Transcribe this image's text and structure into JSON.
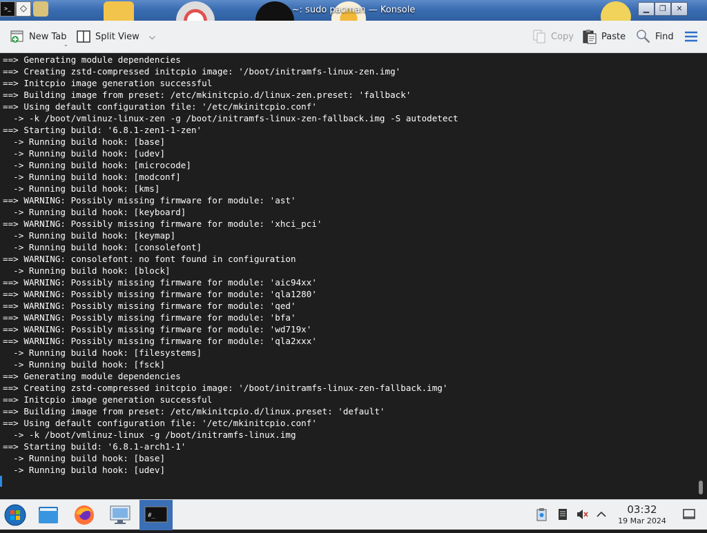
{
  "window": {
    "title": "~: sudo pacman — Konsole",
    "controls": [
      "minimize",
      "maximize",
      "close"
    ]
  },
  "toolbar": {
    "new_tab_label": "New Tab",
    "split_view_label": "Split View",
    "copy_label": "Copy",
    "paste_label": "Paste",
    "find_label": "Find"
  },
  "terminal": {
    "lines": [
      "==> Generating module dependencies",
      "==> Creating zstd-compressed initcpio image: '/boot/initramfs-linux-zen.img'",
      "==> Initcpio image generation successful",
      "==> Building image from preset: /etc/mkinitcpio.d/linux-zen.preset: 'fallback'",
      "==> Using default configuration file: '/etc/mkinitcpio.conf'",
      "  -> -k /boot/vmlinuz-linux-zen -g /boot/initramfs-linux-zen-fallback.img -S autodetect",
      "==> Starting build: '6.8.1-zen1-1-zen'",
      "  -> Running build hook: [base]",
      "  -> Running build hook: [udev]",
      "  -> Running build hook: [microcode]",
      "  -> Running build hook: [modconf]",
      "  -> Running build hook: [kms]",
      "==> WARNING: Possibly missing firmware for module: 'ast'",
      "  -> Running build hook: [keyboard]",
      "==> WARNING: Possibly missing firmware for module: 'xhci_pci'",
      "  -> Running build hook: [keymap]",
      "  -> Running build hook: [consolefont]",
      "==> WARNING: consolefont: no font found in configuration",
      "  -> Running build hook: [block]",
      "==> WARNING: Possibly missing firmware for module: 'aic94xx'",
      "==> WARNING: Possibly missing firmware for module: 'qla1280'",
      "==> WARNING: Possibly missing firmware for module: 'qed'",
      "==> WARNING: Possibly missing firmware for module: 'bfa'",
      "==> WARNING: Possibly missing firmware for module: 'wd719x'",
      "==> WARNING: Possibly missing firmware for module: 'qla2xxx'",
      "  -> Running build hook: [filesystems]",
      "  -> Running build hook: [fsck]",
      "==> Generating module dependencies",
      "==> Creating zstd-compressed initcpio image: '/boot/initramfs-linux-zen-fallback.img'",
      "==> Initcpio image generation successful",
      "==> Building image from preset: /etc/mkinitcpio.d/linux.preset: 'default'",
      "==> Using default configuration file: '/etc/mkinitcpio.conf'",
      "  -> -k /boot/vmlinuz-linux -g /boot/initramfs-linux.img",
      "==> Starting build: '6.8.1-arch1-1'",
      "  -> Running build hook: [base]",
      "  -> Running build hook: [udev]"
    ],
    "cursor_color": "#2b8ae2"
  },
  "taskbar": {
    "launchers": [
      "start-menu-icon",
      "file-manager-icon",
      "firefox-icon",
      "system-settings-icon",
      "konsole-icon"
    ],
    "active_launcher": "konsole-icon",
    "tray": [
      "clipboard-icon",
      "storage-icon",
      "volume-muted-icon",
      "expand-tray-icon"
    ],
    "clock": {
      "time": "03:32",
      "date": "19 Mar 2024"
    }
  },
  "colors": {
    "terminal_bg": "#1e1e1e",
    "terminal_fg": "#fcfcfc",
    "accent": "#2b8ae2",
    "titlebar": "#3a6db2"
  }
}
